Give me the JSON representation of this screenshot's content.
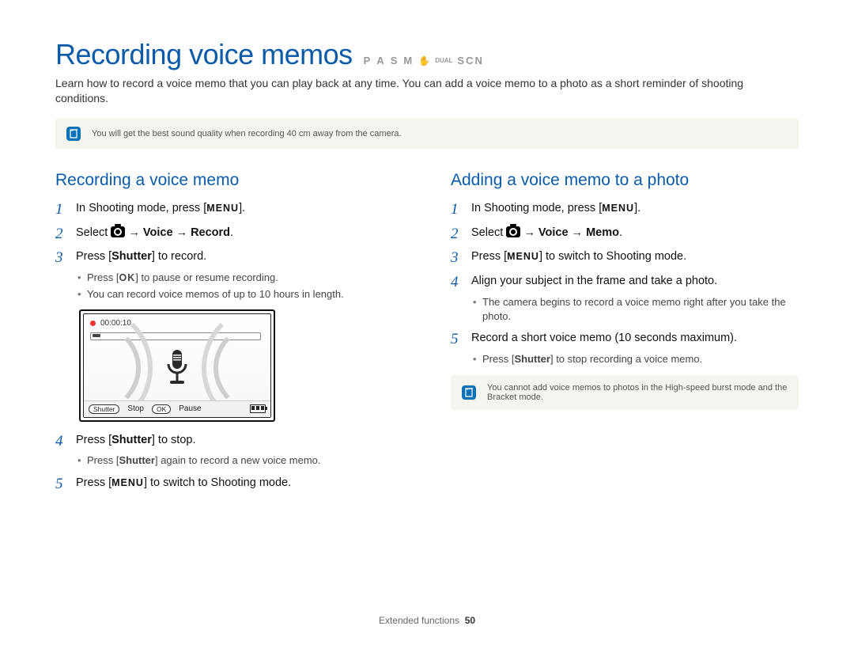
{
  "header": {
    "title": "Recording voice memos",
    "modes": [
      "P",
      "A",
      "S",
      "M"
    ],
    "mode_dual": "DUAL",
    "mode_scn": "SCN"
  },
  "intro": "Learn how to record a voice memo that you can play back at any time. You can add a voice memo to a photo as a short reminder of shooting conditions.",
  "top_note": "You will get the best sound quality when recording 40 cm away from the camera.",
  "left": {
    "heading": "Recording a voice memo",
    "step1_a": "In Shooting mode, press [",
    "step1_menu": "MENU",
    "step1_b": "].",
    "step2_a": "Select ",
    "step2_arrow": " → ",
    "step2_voice": "Voice",
    "step2_record": "Record",
    "step2_period": ".",
    "step3_a": "Press [",
    "step3_shutter": "Shutter",
    "step3_b": "] to record.",
    "step3_sub1_a": "Press [",
    "step3_sub1_ok": "OK",
    "step3_sub1_b": "] to pause or resume recording.",
    "step3_sub2": "You can record voice memos of up to 10 hours in length.",
    "lcd": {
      "time": "00:00:10",
      "shutter": "Shutter",
      "stop": "Stop",
      "ok": "OK",
      "pause": "Pause"
    },
    "step4_a": "Press [",
    "step4_shutter": "Shutter",
    "step4_b": "] to stop.",
    "step4_sub_a": "Press [",
    "step4_sub_shutter": "Shutter",
    "step4_sub_b": "] again to record a new voice memo.",
    "step5_a": "Press [",
    "step5_menu": "MENU",
    "step5_b": "] to switch to Shooting mode."
  },
  "right": {
    "heading": "Adding a voice memo to a photo",
    "step1_a": "In Shooting mode, press [",
    "step1_menu": "MENU",
    "step1_b": "].",
    "step2_a": "Select ",
    "step2_arrow": " → ",
    "step2_voice": "Voice",
    "step2_memo": "Memo",
    "step2_period": ".",
    "step3_a": "Press [",
    "step3_menu": "MENU",
    "step3_b": "] to switch to Shooting mode.",
    "step4": "Align your subject in the frame and take a photo.",
    "step4_sub": "The camera begins to record a voice memo right after you take the photo.",
    "step5": "Record a short voice memo (10 seconds maximum).",
    "step5_sub_a": "Press [",
    "step5_sub_shutter": "Shutter",
    "step5_sub_b": "] to stop recording a voice memo.",
    "note": "You cannot add voice memos to photos in the High-speed burst mode and the Bracket mode."
  },
  "footer": {
    "section": "Extended functions",
    "page": "50"
  }
}
